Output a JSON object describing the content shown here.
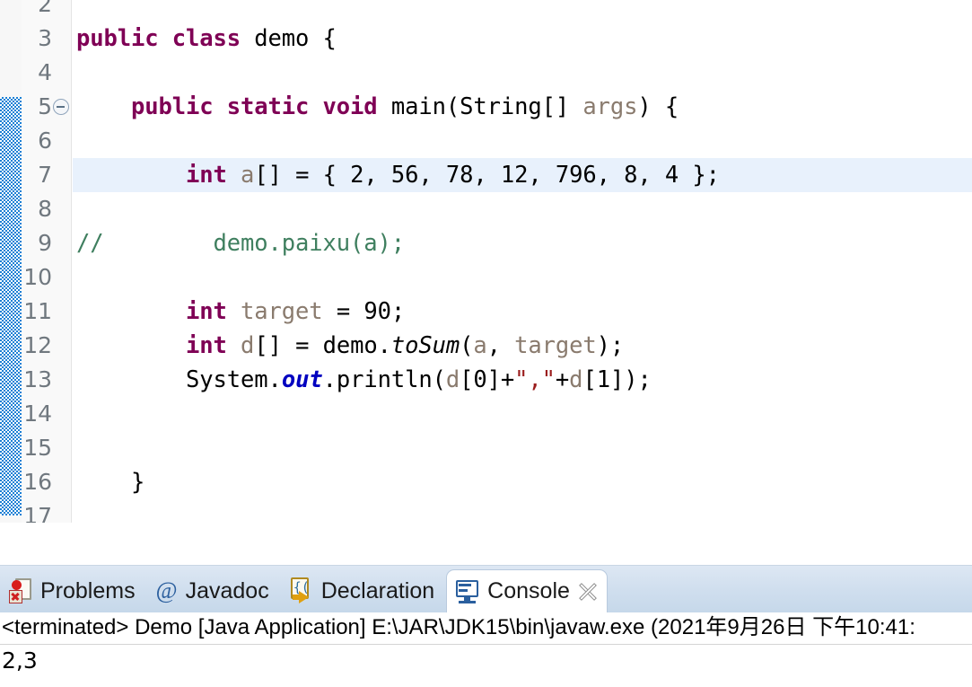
{
  "editor": {
    "first_visible_line": 2,
    "highlighted_line": 7,
    "folding_line": 5,
    "lines": [
      {
        "num": "2",
        "tokens": []
      },
      {
        "num": "3",
        "tokens": [
          {
            "t": "public class ",
            "c": "kw"
          },
          {
            "t": "demo {",
            "c": "plain"
          }
        ]
      },
      {
        "num": "4",
        "tokens": []
      },
      {
        "num": "5",
        "tokens": [
          {
            "t": "    ",
            "c": "plain"
          },
          {
            "t": "public static void ",
            "c": "kw"
          },
          {
            "t": "main(String[] ",
            "c": "plain"
          },
          {
            "t": "args",
            "c": "var"
          },
          {
            "t": ") {",
            "c": "plain"
          }
        ]
      },
      {
        "num": "6",
        "tokens": []
      },
      {
        "num": "7",
        "tokens": [
          {
            "t": "        ",
            "c": "plain"
          },
          {
            "t": "int ",
            "c": "kw"
          },
          {
            "t": "a",
            "c": "var"
          },
          {
            "t": "[] = { 2, 56, 78, 12, 796, 8, 4 };",
            "c": "plain"
          }
        ]
      },
      {
        "num": "8",
        "tokens": []
      },
      {
        "num": "9",
        "tokens": [
          {
            "t": "//        demo.paixu(a);",
            "c": "cmt"
          }
        ]
      },
      {
        "num": "10",
        "tokens": []
      },
      {
        "num": "11",
        "tokens": [
          {
            "t": "        ",
            "c": "plain"
          },
          {
            "t": "int ",
            "c": "kw"
          },
          {
            "t": "target",
            "c": "var"
          },
          {
            "t": " = 90;",
            "c": "plain"
          }
        ]
      },
      {
        "num": "12",
        "tokens": [
          {
            "t": "        ",
            "c": "plain"
          },
          {
            "t": "int ",
            "c": "kw"
          },
          {
            "t": "d",
            "c": "var"
          },
          {
            "t": "[] = demo.",
            "c": "plain"
          },
          {
            "t": "toSum",
            "c": "stat"
          },
          {
            "t": "(",
            "c": "plain"
          },
          {
            "t": "a",
            "c": "var"
          },
          {
            "t": ", ",
            "c": "plain"
          },
          {
            "t": "target",
            "c": "var"
          },
          {
            "t": ");",
            "c": "plain"
          }
        ]
      },
      {
        "num": "13",
        "tokens": [
          {
            "t": "        ",
            "c": "plain"
          },
          {
            "t": "System.",
            "c": "plain"
          },
          {
            "t": "out",
            "c": "sfield"
          },
          {
            "t": ".println(",
            "c": "plain"
          },
          {
            "t": "d",
            "c": "var"
          },
          {
            "t": "[0]+",
            "c": "plain"
          },
          {
            "t": "\",\"",
            "c": "str"
          },
          {
            "t": "+",
            "c": "plain"
          },
          {
            "t": "d",
            "c": "var"
          },
          {
            "t": "[1]);",
            "c": "plain"
          }
        ]
      },
      {
        "num": "14",
        "tokens": []
      },
      {
        "num": "15",
        "tokens": []
      },
      {
        "num": "16",
        "tokens": [
          {
            "t": "    }",
            "c": "plain"
          }
        ]
      },
      {
        "num": "17",
        "tokens": []
      }
    ],
    "scroll_left_arrow": "‹"
  },
  "bottom_tabs": [
    {
      "id": "problems",
      "label": "Problems",
      "icon": "problems-icon",
      "active": false,
      "closable": false
    },
    {
      "id": "javadoc",
      "label": "Javadoc",
      "icon": "at-sign-icon",
      "active": false,
      "closable": false
    },
    {
      "id": "declaration",
      "label": "Declaration",
      "icon": "declaration-icon",
      "active": false,
      "closable": false
    },
    {
      "id": "console",
      "label": "Console",
      "icon": "console-icon",
      "active": true,
      "closable": true
    }
  ],
  "console": {
    "header": "<terminated> Demo [Java Application] E:\\JAR\\JDK15\\bin\\javaw.exe  (2021年9月26日 下午10:41:",
    "output": "2,3"
  },
  "colors": {
    "keyword": "#7f0055",
    "comment": "#3f7f5f",
    "string": "#9b1d1d",
    "static_field": "#0000c0",
    "local_var": "#8a7b6e",
    "highlight_row": "#e8f1fc",
    "change_bar": "#1a7fd4",
    "tab_active_bg": "#ffffff",
    "tabbar_bg": "#cfdeee"
  }
}
